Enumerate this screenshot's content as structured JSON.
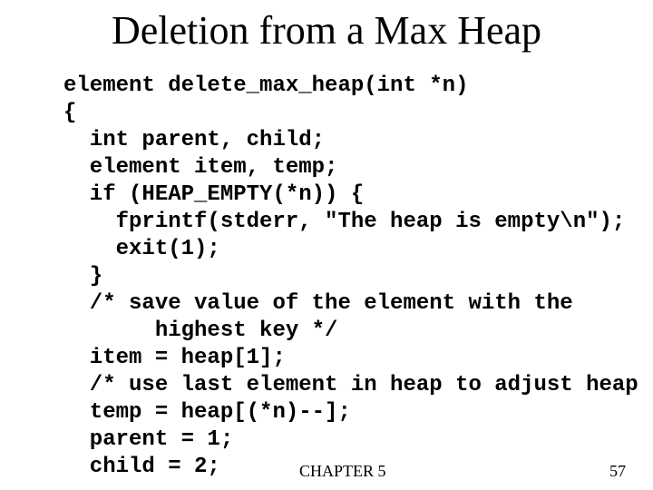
{
  "slide": {
    "title": "Deletion from a Max Heap",
    "code": "element delete_max_heap(int *n)\n{\n  int parent, child;\n  element item, temp;\n  if (HEAP_EMPTY(*n)) {\n    fprintf(stderr, \"The heap is empty\\n\");\n    exit(1);\n  }\n  /* save value of the element with the\n       highest key */\n  item = heap[1];\n  /* use last element in heap to adjust heap\n  temp = heap[(*n)--];\n  parent = 1;\n  child = 2;",
    "footer_chapter": "CHAPTER 5",
    "footer_page": "57"
  }
}
